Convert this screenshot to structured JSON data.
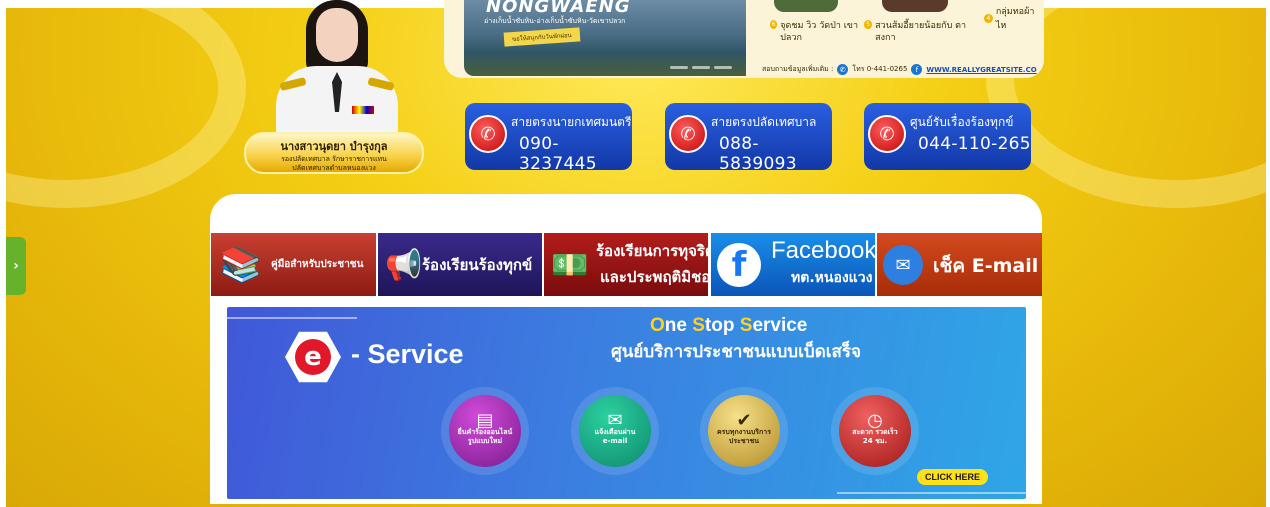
{
  "banner": {
    "lake_title": "NONGWAENG",
    "lake_subtitle": "อ่างเก็บน้ำซับหิน-อ่างเก็บน้ำซับหิน-วัดเขาปลวก",
    "lake_tag": "ขอให้สนุกกับวันพักผ่อน",
    "items": [
      {
        "num": "4",
        "label": "กลุ่มทอผ้าไห"
      },
      {
        "num": "6",
        "label": "จุดชม วิว วัดป่า เขาปลวก"
      },
      {
        "num": "5",
        "label": "สวนส้มอี้ยายน้อยกับ ตาสงกา"
      }
    ],
    "contact_prefix": "สอบถามข้อมูลเพิ่มเติม :",
    "contact_phone": "โทร 0-441-0265",
    "contact_web": "WWW.REALLYGREATSITE.CO"
  },
  "official": {
    "name": "นางสาวนุดยา บำรุงกุล",
    "role_line1": "รองปลัดเทศบาล รักษาราชการแทน",
    "role_line2": "ปลัดเทศบาลตำบลหนองแวง"
  },
  "hotlines": [
    {
      "title": "สายตรงนายกเทศมนตรี",
      "number": "090-3237445"
    },
    {
      "title": "สายตรงปลัดเทศบาล",
      "number": "088-5839093"
    },
    {
      "title": "ศูนย์รับเรื่องร้องทุกข์",
      "number": "044-110-265"
    }
  ],
  "quick_buttons": [
    {
      "label": "คู่มือสำหรับประชาชน"
    },
    {
      "label": "ร้องเรียนร้องทุกข์"
    },
    {
      "label_line1": "ร้องเรียนการทุจริต",
      "label_line2": "และประพฤติมิชอบ"
    },
    {
      "label_line1": "Facebook",
      "label_line2": "ทต.หนองแวง"
    },
    {
      "label": "เช็ค E-mail"
    }
  ],
  "eservice": {
    "logo_letter": "e",
    "service_word": "- Service",
    "title_parts": [
      "O",
      "ne ",
      "S",
      "top ",
      "S",
      "ervice"
    ],
    "subtitle": "ศูนย์บริการประชาชนแบบเบ็ดเสร็จ",
    "circles": [
      {
        "line1": "ยื่นคำร้องออนไลน์",
        "line2": "รูปแบบใหม่",
        "icon": "document-icon"
      },
      {
        "line1": "แจ้งเตือนผ่าน",
        "line2": "e-mail",
        "icon": "mail-icon"
      },
      {
        "line1": "ครบทุกงานบริการ",
        "line2": "ประชาชน",
        "icon": "check-icon"
      },
      {
        "line1": "สะดวก รวดเร็ว",
        "line2": "24 ชม.",
        "icon": "clock-icon"
      }
    ],
    "cta": "CLICK HERE"
  },
  "side_tab": {
    "glyph": "›"
  },
  "colors": {
    "background_gold": "#f4cf14",
    "hotline_blue": "#1238a8",
    "phone_red": "#c30808",
    "side_tab_green": "#66b22a",
    "cta_yellow": "#ffe01a"
  }
}
